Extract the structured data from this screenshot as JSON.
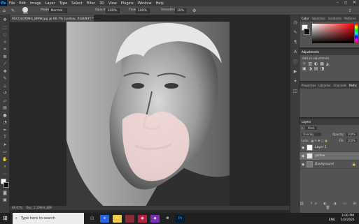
{
  "app": {
    "logo": "Ps"
  },
  "menu": [
    "File",
    "Edit",
    "Image",
    "Layer",
    "Type",
    "Select",
    "Filter",
    "3D",
    "View",
    "Plugins",
    "Window",
    "Help"
  ],
  "options": {
    "mode_label": "Mode:",
    "mode_value": "Normal",
    "opacity_label": "Opacity:",
    "opacity_value": "100%",
    "flow_label": "Flow:",
    "flow_value": "100%",
    "smoothing_label": "Smoothing:",
    "smoothing_value": "10%",
    "brush_size": "500"
  },
  "document": {
    "tab_title": "RECOLORING_BMW.jpg @ 66.7% (yellow, RGB/8#) *",
    "zoom": "66.67%",
    "doc_info": "Doc: 2.19M/4.38M"
  },
  "panels": {
    "color_tabs": [
      "Color",
      "Swatches",
      "Gradients",
      "Patterns"
    ],
    "adjustments_title": "Adjustments",
    "adjustments_hint": "Add an adjustment",
    "properties_tabs": [
      "Properties",
      "Libraries",
      "Channels",
      "Paths"
    ],
    "layers_title": "Layers",
    "filter_kind": "Kind",
    "blend_mode": "Overlay",
    "opacity_label": "Opacity:",
    "opacity_value": "100%",
    "lock_label": "Lock:",
    "fill_label": "Fill:",
    "fill_value": "100%",
    "layers": [
      {
        "name": "Layer 1"
      },
      {
        "name": "yellow"
      },
      {
        "name": "Background"
      }
    ]
  },
  "taskbar": {
    "search_placeholder": "Type here to search",
    "lang": "ENG",
    "time": "3:00 PM",
    "date": "5/3/2021"
  },
  "colors": {
    "accent": "#31a8ff",
    "skin_overlay": "#f2d7d5",
    "selected_color": "#c2002a"
  }
}
